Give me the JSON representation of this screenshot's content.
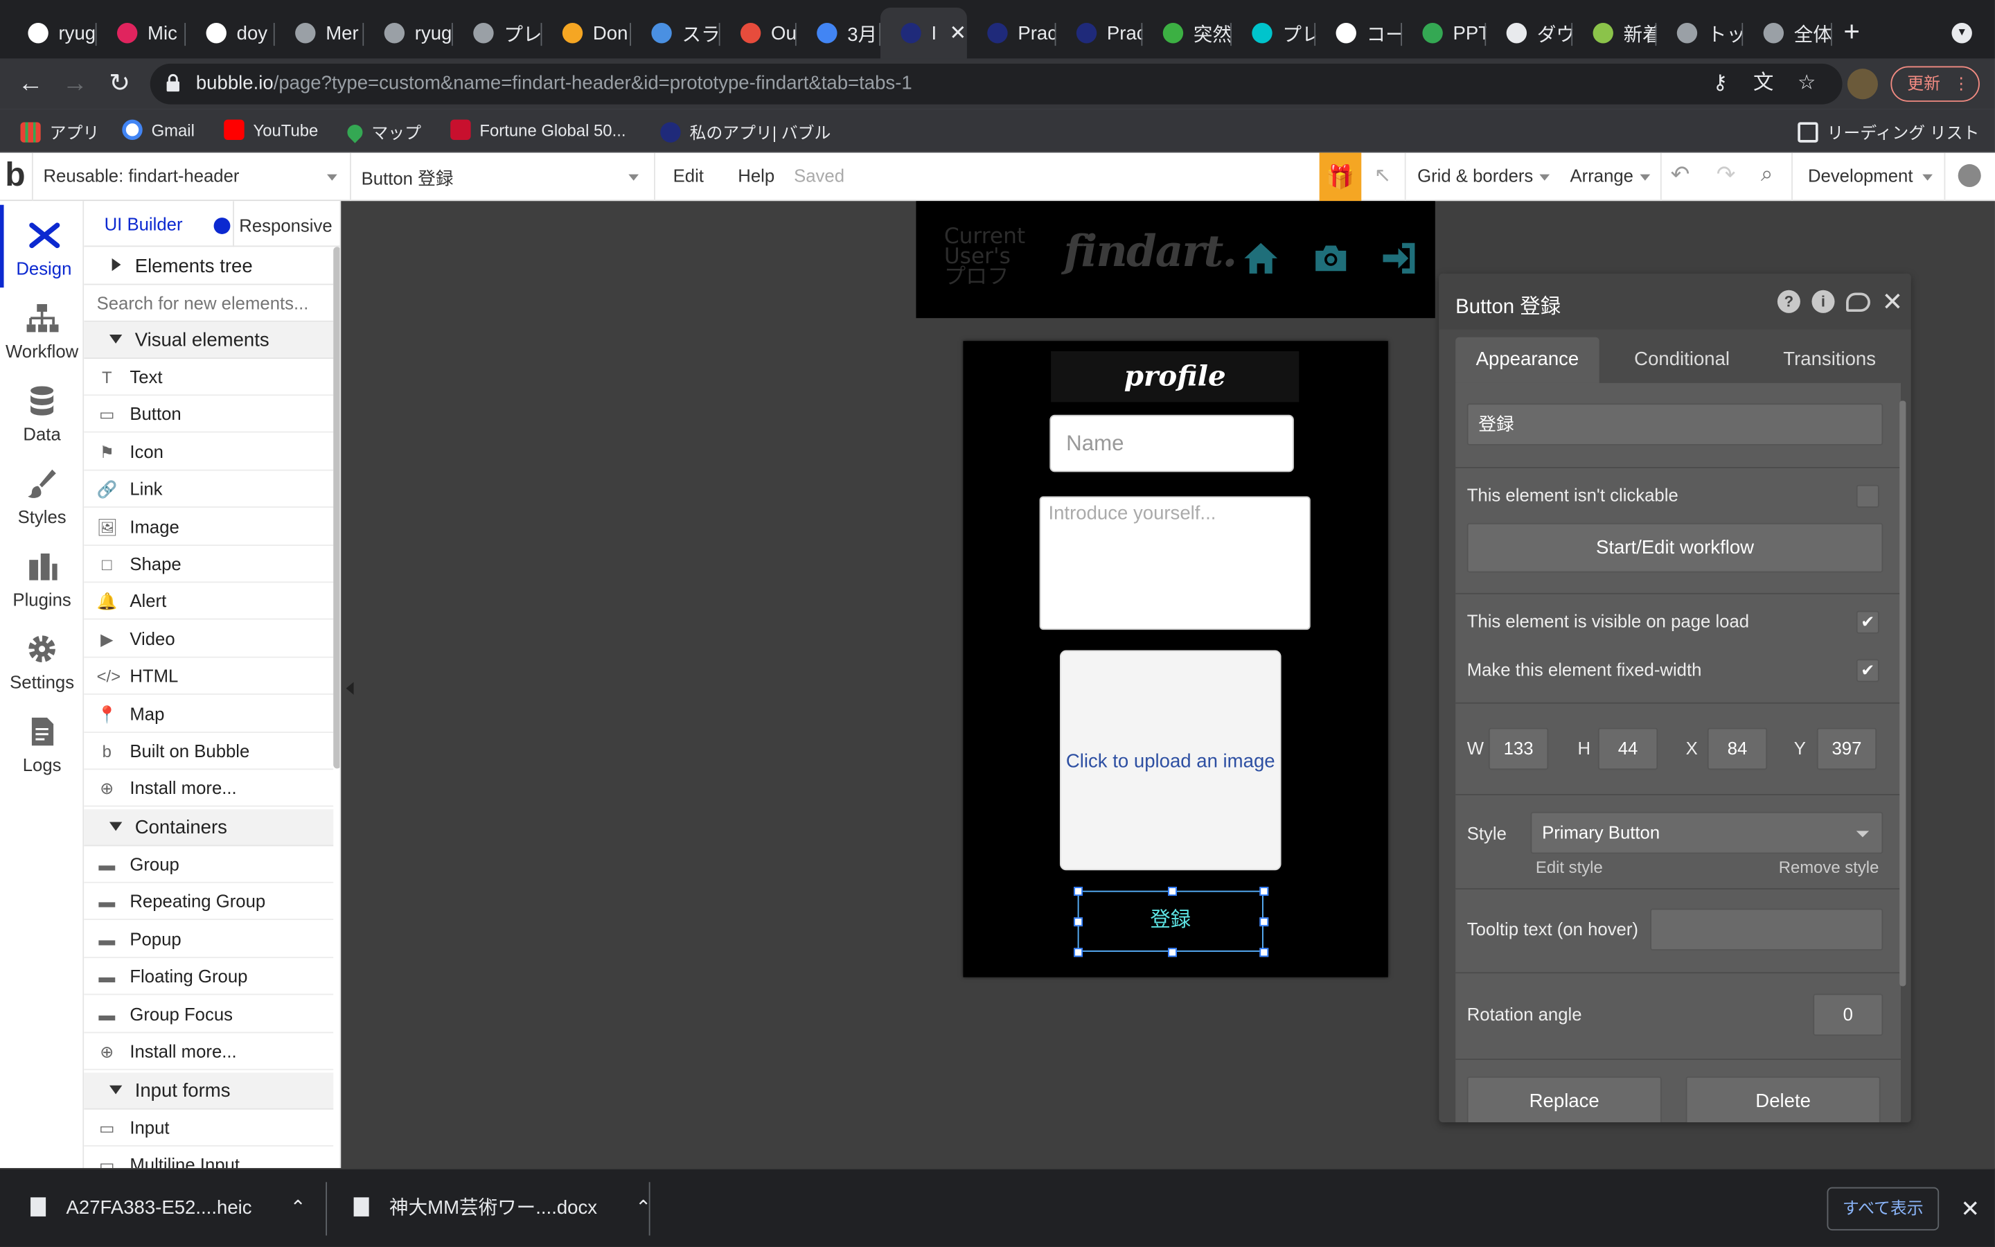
{
  "browser": {
    "tabs": [
      {
        "label": "ryug",
        "color": "#ffffff"
      },
      {
        "label": "Mic",
        "color": "#e0245e"
      },
      {
        "label": "doy",
        "color": "#ffffff"
      },
      {
        "label": "Mer",
        "color": "#9aa0a6"
      },
      {
        "label": "ryug",
        "color": "#9aa0a6"
      },
      {
        "label": "プレ",
        "color": "#9aa0a6"
      },
      {
        "label": "Don",
        "color": "#f5a623"
      },
      {
        "label": "スラ",
        "color": "#4a90e2"
      },
      {
        "label": "Out",
        "color": "#e74c3c"
      },
      {
        "label": "3月",
        "color": "#4285f4"
      },
      {
        "label": "I",
        "color": "#1f2a7a"
      },
      {
        "label": "Prac",
        "color": "#1f2a7a"
      },
      {
        "label": "Prac",
        "color": "#1f2a7a"
      },
      {
        "label": "突然",
        "color": "#3cb043"
      },
      {
        "label": "プレ",
        "color": "#00c4cc"
      },
      {
        "label": "コー",
        "color": "#ffffff"
      },
      {
        "label": "PPT",
        "color": "#34a853"
      },
      {
        "label": "ダウ",
        "color": "#e8eaed"
      },
      {
        "label": "新着",
        "color": "#8bc34a"
      },
      {
        "label": "トッ",
        "color": "#9aa0a6"
      },
      {
        "label": "全体",
        "color": "#9aa0a6"
      }
    ],
    "active_tab_index": 10,
    "url_domain": "bubble.io",
    "url_path": "/page?type=custom&name=findart-header&id=prototype-findart&tab=tabs-1",
    "update_label": "更新",
    "bookmarks": [
      {
        "label": "アプリ"
      },
      {
        "label": "Gmail"
      },
      {
        "label": "YouTube"
      },
      {
        "label": "マップ"
      },
      {
        "label": "Fortune Global 50..."
      },
      {
        "label": "私のアプリ| バブル"
      }
    ],
    "reading_list": "リーディング リスト"
  },
  "editor_bar": {
    "page_select": "Reusable: findart-header",
    "element_select": "Button 登録",
    "menu": [
      "Edit",
      "Help"
    ],
    "status": "Saved",
    "grid": "Grid & borders",
    "arrange": "Arrange",
    "env": "Development"
  },
  "rail": [
    {
      "label": "Design",
      "active": true
    },
    {
      "label": "Workflow"
    },
    {
      "label": "Data"
    },
    {
      "label": "Styles"
    },
    {
      "label": "Plugins"
    },
    {
      "label": "Settings"
    },
    {
      "label": "Logs"
    }
  ],
  "element_panel": {
    "tab_builder": "UI Builder",
    "tab_responsive": "Responsive",
    "tree": "Elements tree",
    "search_placeholder": "Search for new elements...",
    "visual_header": "Visual elements",
    "visual": [
      "Text",
      "Button",
      "Icon",
      "Link",
      "Image",
      "Shape",
      "Alert",
      "Video",
      "HTML",
      "Map",
      "Built on Bubble",
      "Install more..."
    ],
    "containers_header": "Containers",
    "containers": [
      "Group",
      "Repeating Group",
      "Popup",
      "Floating Group",
      "Group Focus",
      "Install more..."
    ],
    "inputs_header": "Input forms",
    "inputs": [
      "Input",
      "Multiline Input"
    ]
  },
  "canvas": {
    "header_user": "Current User's プロフ",
    "header_logo": "findart.",
    "profile_title": "profile",
    "name_placeholder": "Name",
    "intro_placeholder": "Introduce yourself...",
    "upload_text": "Click to upload an image",
    "button_label": "登録"
  },
  "property_editor": {
    "title": "Button 登録",
    "tabs": [
      "Appearance",
      "Conditional",
      "Transitions"
    ],
    "button_text": "登録",
    "not_clickable": "This element isn't clickable",
    "workflow": "Start/Edit workflow",
    "visible_on_load": "This element is visible on page load",
    "visible_checked": true,
    "fixed_width": "Make this element fixed-width",
    "fixed_checked": true,
    "w_label": "W",
    "w": "133",
    "h_label": "H",
    "h": "44",
    "x_label": "X",
    "x": "84",
    "y_label": "Y",
    "y": "397",
    "style_label": "Style",
    "style_value": "Primary Button",
    "edit_style": "Edit style",
    "remove_style": "Remove style",
    "tooltip": "Tooltip text (on hover)",
    "rotation": "Rotation angle",
    "rotation_value": "0",
    "replace": "Replace",
    "delete": "Delete"
  },
  "downloads": {
    "items": [
      {
        "name": "A27FA383-E52....heic"
      },
      {
        "name": "神大MM芸術ワー....docx"
      }
    ],
    "show_all": "すべて表示"
  },
  "colors": {
    "bubble_blue": "#0c29d0",
    "gift_orange": "#f5a623",
    "header_icon_teal": "#1f6f7a",
    "selection_blue": "#2a79ff"
  }
}
